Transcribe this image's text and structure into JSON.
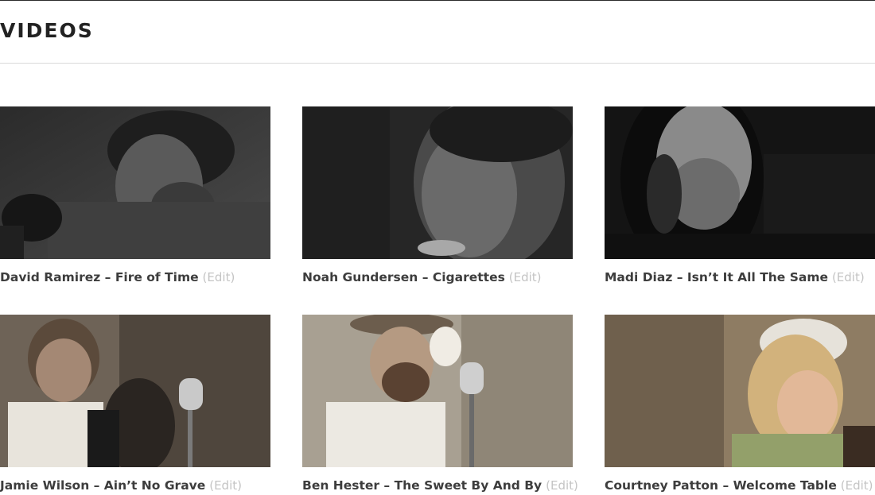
{
  "page": {
    "title": "VIDEOS"
  },
  "videos": [
    {
      "title": "David Ramirez – Fire of Time",
      "edit_label": "(Edit)",
      "tone": "dark"
    },
    {
      "title": "Noah Gundersen – Cigarettes",
      "edit_label": "(Edit)",
      "tone": "dark"
    },
    {
      "title": "Madi Diaz – Isn’t It All The Same",
      "edit_label": "(Edit)",
      "tone": "dark"
    },
    {
      "title": "Jamie Wilson – Ain’t No Grave",
      "edit_label": "(Edit)",
      "tone": "warm"
    },
    {
      "title": "Ben Hester – The Sweet By And By",
      "edit_label": "(Edit)",
      "tone": "warm"
    },
    {
      "title": "Courtney Patton – Welcome Table",
      "edit_label": "(Edit)",
      "tone": "warm"
    }
  ],
  "colors": {
    "title": "#222222",
    "caption": "#3d3d3d",
    "edit": "#c4c4c4",
    "divider": "#d9d9d9"
  }
}
